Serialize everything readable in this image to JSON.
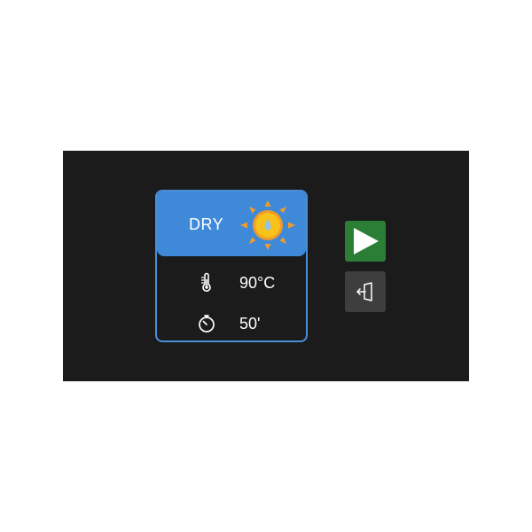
{
  "program": {
    "name": "DRY",
    "icon": "sun-icon",
    "temperature": "90°C",
    "temperature_icon": "thermometer-icon",
    "duration": "50'",
    "duration_icon": "timer-icon"
  },
  "controls": {
    "start_icon": "play-icon",
    "door_icon": "door-open-icon"
  },
  "colors": {
    "panel_background": "#1b1b1b",
    "accent_blue": "#3f8ad8",
    "start_green": "#2a7e35",
    "secondary_gray": "#3e3e3e",
    "sun_yellow": "#f7c21a",
    "sun_orange": "#f29b2a"
  }
}
